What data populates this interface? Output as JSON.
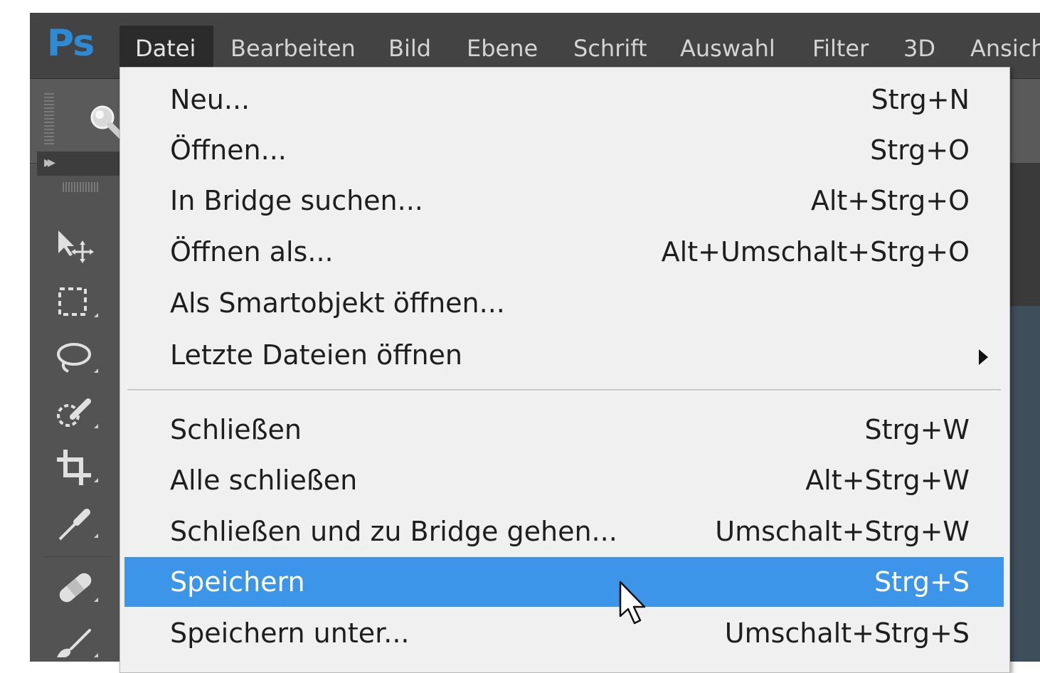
{
  "app": {
    "logo": "Ps"
  },
  "menubar": {
    "items": [
      {
        "label": "Datei"
      },
      {
        "label": "Bearbeiten"
      },
      {
        "label": "Bild"
      },
      {
        "label": "Ebene"
      },
      {
        "label": "Schrift"
      },
      {
        "label": "Auswahl"
      },
      {
        "label": "Filter"
      },
      {
        "label": "3D"
      },
      {
        "label": "Ansich"
      }
    ],
    "active": "Datei"
  },
  "file_menu": {
    "items": [
      {
        "label": "Neu...",
        "shortcut": "Strg+N"
      },
      {
        "label": "Öffnen...",
        "shortcut": "Strg+O"
      },
      {
        "label": "In Bridge suchen...",
        "shortcut": "Alt+Strg+O"
      },
      {
        "label": "Öffnen als...",
        "shortcut": "Alt+Umschalt+Strg+O"
      },
      {
        "label": "Als Smartobjekt öffnen...",
        "shortcut": ""
      },
      {
        "label": "Letzte Dateien öffnen",
        "shortcut": "",
        "submenu": true
      },
      {
        "label": "Schließen",
        "shortcut": "Strg+W"
      },
      {
        "label": "Alle schließen",
        "shortcut": "Alt+Strg+W"
      },
      {
        "label": "Schließen und zu Bridge gehen...",
        "shortcut": "Umschalt+Strg+W"
      },
      {
        "label": "Speichern",
        "shortcut": "Strg+S",
        "highlighted": true
      },
      {
        "label": "Speichern unter...",
        "shortcut": "Umschalt+Strg+S"
      }
    ]
  },
  "toolbar": {
    "tools": [
      "move-tool-icon",
      "marquee-tool-icon",
      "lasso-tool-icon",
      "quick-selection-tool-icon",
      "crop-tool-icon",
      "eyedropper-tool-icon",
      "healing-brush-tool-icon",
      "brush-tool-icon"
    ]
  },
  "colors": {
    "accent": "#3c95e8",
    "logo": "#2d8bd6",
    "menubar_bg": "#434343",
    "menu_bg": "#f0f0f0"
  }
}
